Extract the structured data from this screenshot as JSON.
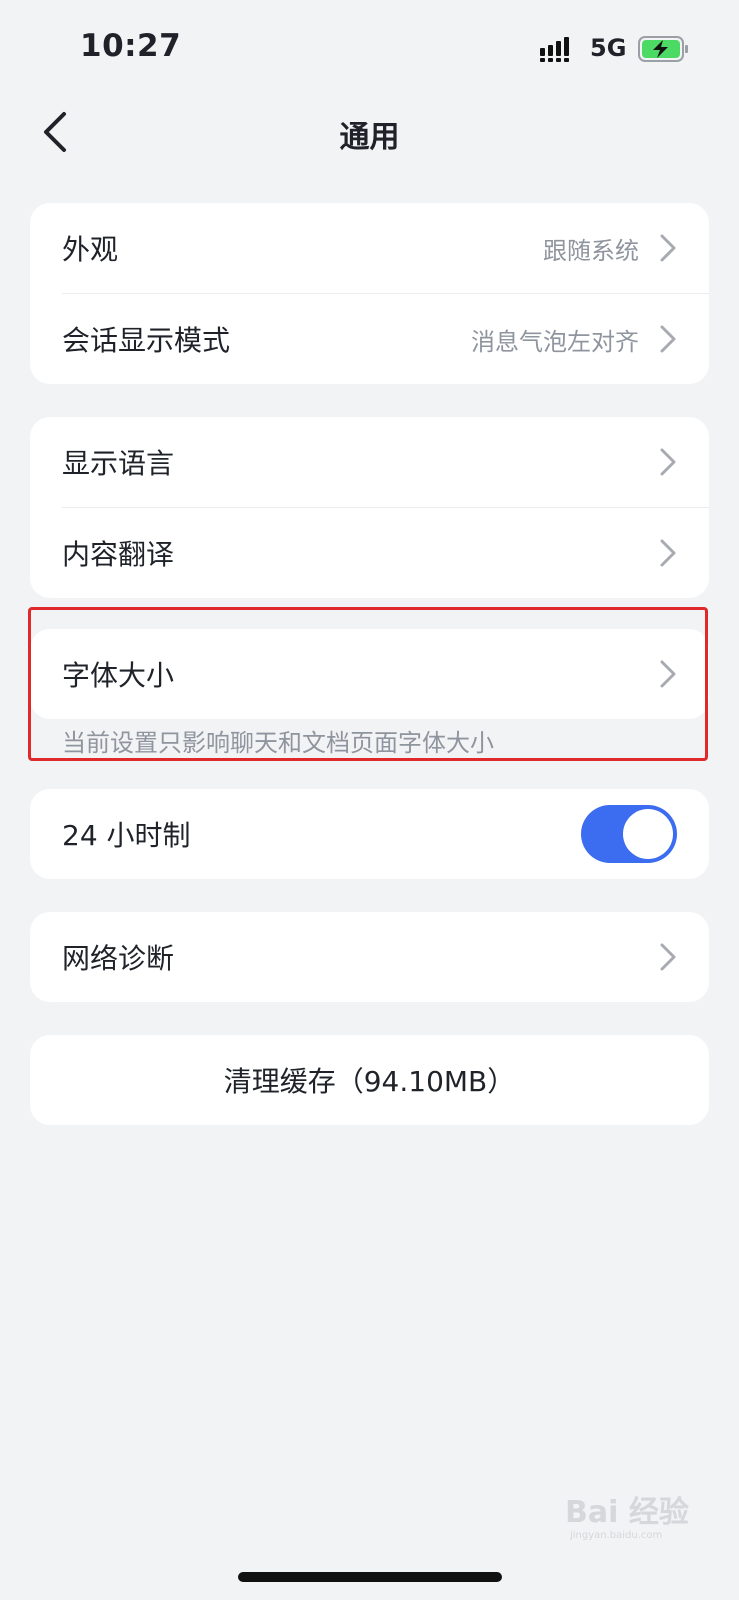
{
  "status_bar": {
    "time": "10:27",
    "network": "5G",
    "signal_icon": "signal-bars-icon",
    "battery_icon": "battery-charging-icon",
    "battery_color": "#4cd964"
  },
  "nav": {
    "title": "通用",
    "back_icon": "chevron-left-icon"
  },
  "group1": {
    "items": [
      {
        "label": "外观",
        "value": "跟随系统"
      },
      {
        "label": "会话显示模式",
        "value": "消息气泡左对齐"
      }
    ]
  },
  "group2": {
    "items": [
      {
        "label": "显示语言"
      },
      {
        "label": "内容翻译"
      }
    ]
  },
  "font_size": {
    "label": "字体大小",
    "hint": "当前设置只影响聊天和文档页面字体大小",
    "highlight_color": "#e0292b"
  },
  "time_format": {
    "label": "24 小时制",
    "enabled": true,
    "accent": "#3c6cf0"
  },
  "network": {
    "label": "网络诊断"
  },
  "cache": {
    "label": "清理缓存（94.10MB）"
  },
  "watermark": {
    "text": "Bai 经验",
    "sub": "jingyan.baidu.com"
  }
}
